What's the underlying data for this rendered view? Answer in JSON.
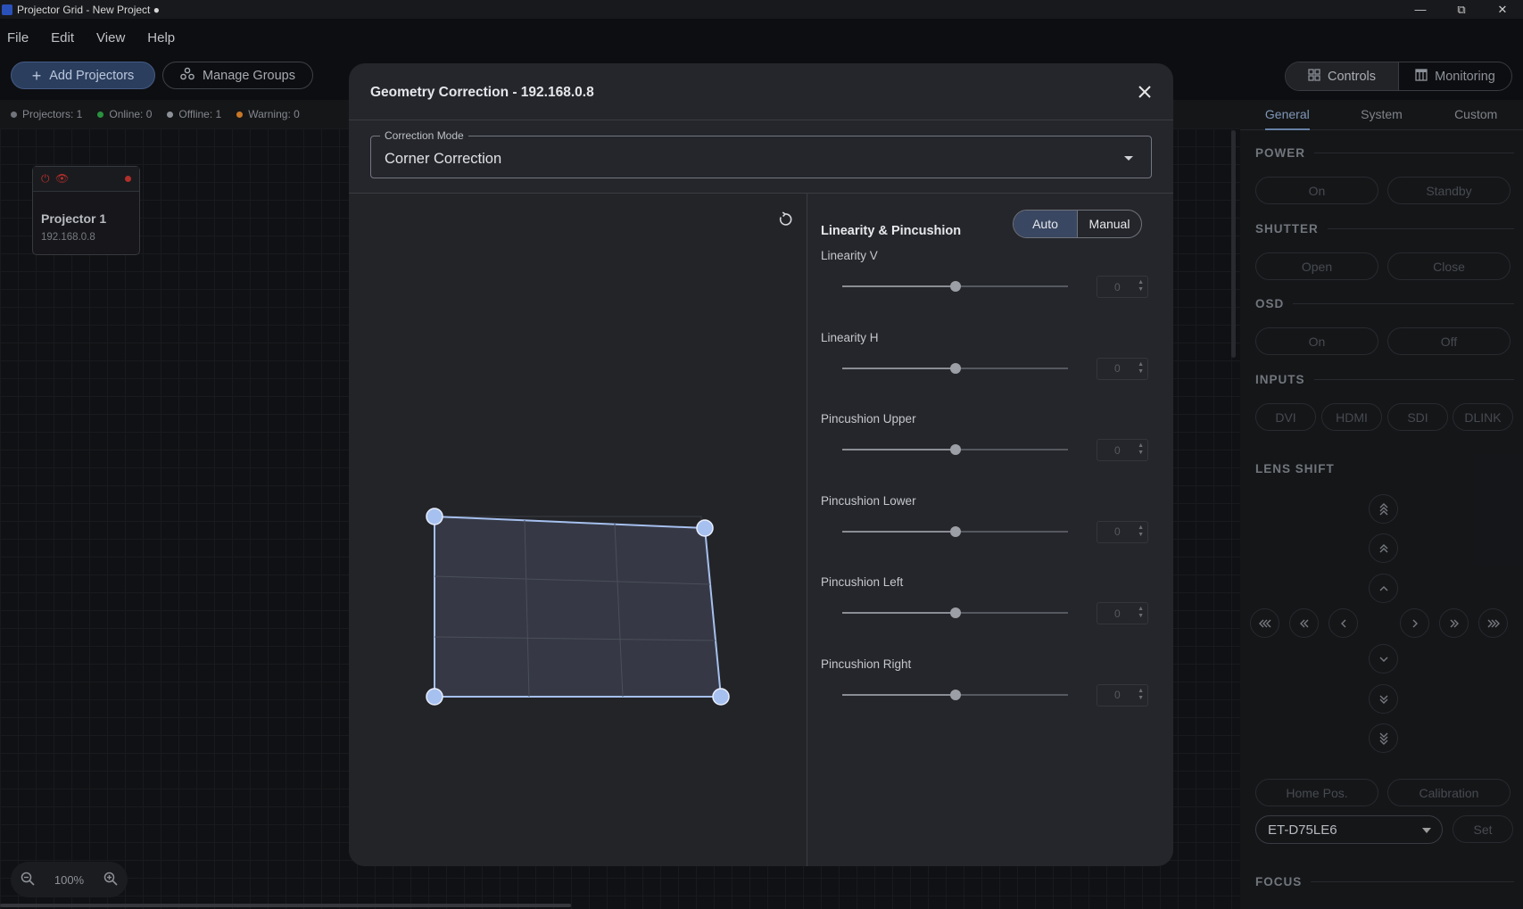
{
  "window": {
    "title": "Projector Grid - New Project ●"
  },
  "menu": [
    "File",
    "Edit",
    "View",
    "Help"
  ],
  "toolbar": {
    "add_label": "Add Projectors",
    "manage_label": "Manage Groups"
  },
  "status": {
    "projectors": "Projectors: 1",
    "online": "Online: 0",
    "offline": "Offline: 1",
    "warning": "Warning: 0",
    "colors": {
      "projectors": "#7b7f86",
      "online": "#2e9e45",
      "offline": "#9a9ea5",
      "warning": "#d9822b"
    }
  },
  "projector_card": {
    "name": "Projector 1",
    "ip": "192.168.0.8",
    "status_color": "#c0332f"
  },
  "zoom": {
    "value": "100%"
  },
  "view_tabs": {
    "controls": "Controls",
    "monitoring": "Monitoring"
  },
  "right_panel": {
    "tabs": [
      "General",
      "System",
      "Custom"
    ],
    "power": {
      "title": "POWER",
      "on": "On",
      "standby": "Standby"
    },
    "shutter": {
      "title": "SHUTTER",
      "open": "Open",
      "close": "Close"
    },
    "osd": {
      "title": "OSD",
      "on": "On",
      "off": "Off"
    },
    "inputs": {
      "title": "INPUTS",
      "items": [
        "DVI",
        "HDMI",
        "SDI",
        "DLINK"
      ]
    },
    "lens_shift": {
      "title": "LENS SHIFT",
      "home": "Home Pos.",
      "calibration": "Calibration"
    },
    "lens": {
      "selected": "ET-D75LE6",
      "set": "Set"
    },
    "focus": {
      "title": "FOCUS"
    }
  },
  "modal": {
    "title": "Geometry Correction - 192.168.0.8",
    "mode_legend": "Correction Mode",
    "mode_value": "Corner Correction",
    "panel_title": "Linearity & Pincushion",
    "toggle": {
      "auto": "Auto",
      "manual": "Manual",
      "selected": "Auto"
    },
    "sliders": [
      {
        "label": "Linearity V",
        "value": "0",
        "level": 0.5
      },
      {
        "label": "Linearity H",
        "value": "0",
        "level": 0.5
      },
      {
        "label": "Pincushion Upper",
        "value": "0",
        "level": 0.5
      },
      {
        "label": "Pincushion Lower",
        "value": "0",
        "level": 0.5
      },
      {
        "label": "Pincushion Left",
        "value": "0",
        "level": 0.5
      },
      {
        "label": "Pincushion Right",
        "value": "0",
        "level": 0.5
      }
    ]
  }
}
